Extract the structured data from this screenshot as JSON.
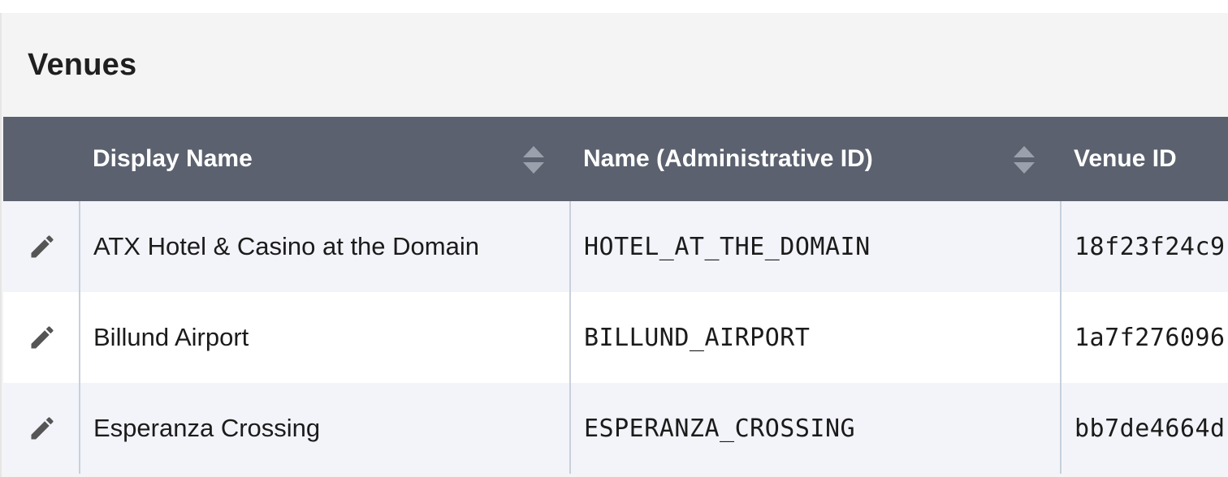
{
  "panel": {
    "title": "Venues"
  },
  "table": {
    "columns": [
      {
        "label": "Display Name",
        "sortable": true
      },
      {
        "label": "Name (Administrative ID)",
        "sortable": true
      },
      {
        "label": "Venue ID",
        "sortable": false
      }
    ],
    "rows": [
      {
        "display_name": "ATX Hotel & Casino at the Domain",
        "admin_id": "HOTEL_AT_THE_DOMAIN",
        "venue_id": "18f23f24c9"
      },
      {
        "display_name": "Billund Airport",
        "admin_id": "BILLUND_AIRPORT",
        "venue_id": "1a7f276096"
      },
      {
        "display_name": "Esperanza Crossing",
        "admin_id": "ESPERANZA_CROSSING",
        "venue_id": "bb7de4664d"
      }
    ]
  },
  "icons": {
    "edit": "pencil-icon",
    "sort": "sort-updown-icon"
  },
  "colors": {
    "header_bg": "#5b616e",
    "header_text": "#ffffff",
    "row_alt_bg": "#f3f4f9",
    "panel_bg": "#f4f4f4",
    "cell_divider": "#c7d0dc",
    "sort_icon": "#9aa1ad",
    "edit_icon": "#555555"
  }
}
